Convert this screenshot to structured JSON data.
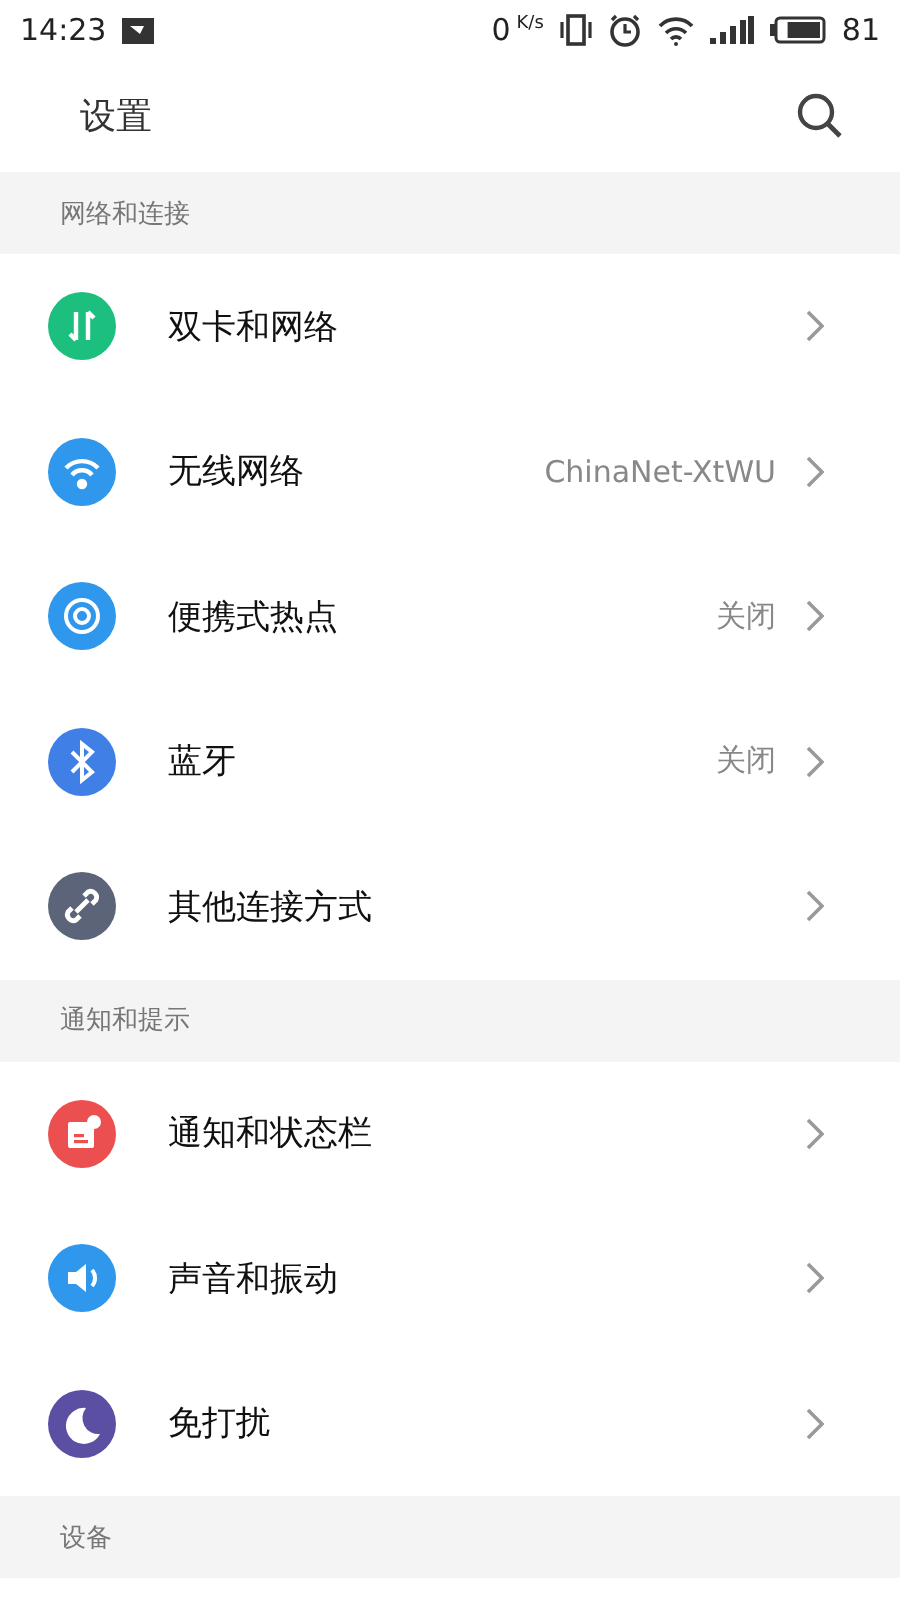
{
  "status_bar": {
    "time": "14:23",
    "speed": "0",
    "speed_unit": "K/s",
    "battery": "81",
    "level": 0.81
  },
  "header": {
    "title": "设置"
  },
  "sections": [
    {
      "title": "网络和连接",
      "items": [
        {
          "label": "双卡和网络",
          "color": "#1dbf7f"
        },
        {
          "label": "无线网络",
          "value": "ChinaNet-XtWU",
          "color": "#2f98ec"
        },
        {
          "label": "便携式热点",
          "value": "关闭",
          "color": "#2f98ec"
        },
        {
          "label": "蓝牙",
          "value": "关闭",
          "color": "#3f7fe6"
        },
        {
          "label": "其他连接方式",
          "color": "#5b6478"
        }
      ]
    },
    {
      "title": "通知和提示",
      "items": [
        {
          "label": "通知和状态栏",
          "color": "#ec4f4f"
        },
        {
          "label": "声音和振动",
          "color": "#2f98ec"
        },
        {
          "label": "免打扰",
          "color": "#5a4fa3"
        }
      ]
    },
    {
      "title": "设备"
    }
  ]
}
